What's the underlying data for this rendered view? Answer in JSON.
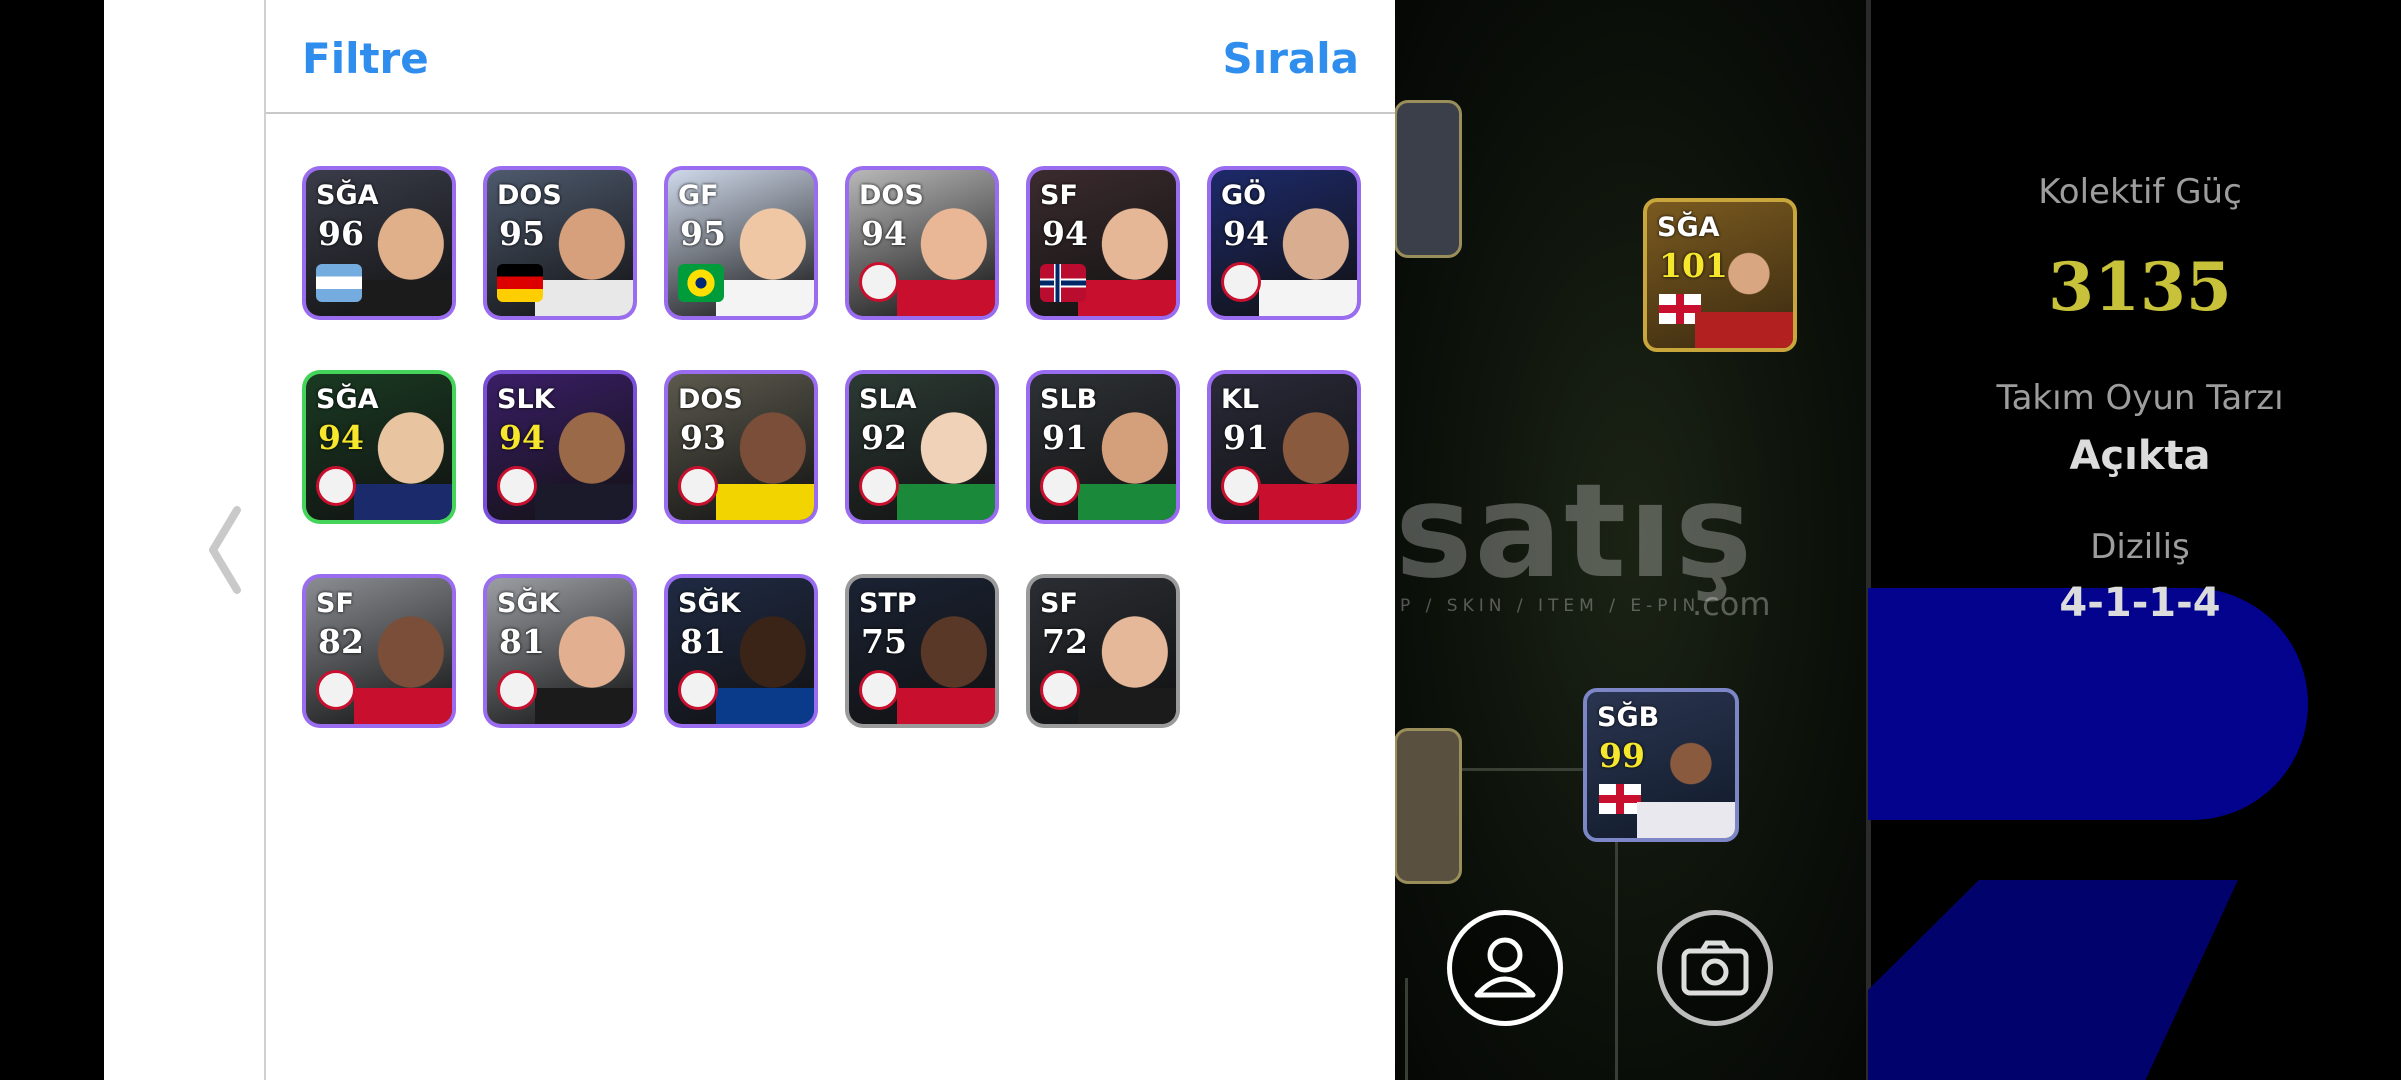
{
  "panel": {
    "filter_label": "Filtre",
    "sort_label": "Sırala"
  },
  "cards": [
    {
      "position": "SĞA",
      "rating": "96",
      "bg": "#3a3d4a",
      "frame": "#9a6cf0",
      "gold": false,
      "badge": "argentina-flag"
    },
    {
      "position": "DOS",
      "rating": "95",
      "bg": "#4e5a6e",
      "frame": "#9a6cf0",
      "gold": false,
      "badge": "germany-flag"
    },
    {
      "position": "GF",
      "rating": "95",
      "bg": "#cfd9ea",
      "frame": "#9a6cf0",
      "gold": false,
      "badge": "brazil-flag"
    },
    {
      "position": "DOS",
      "rating": "94",
      "bg": "#b8b8b8",
      "frame": "#9a6cf0",
      "gold": false,
      "badge": "man-utd-crest"
    },
    {
      "position": "SF",
      "rating": "94",
      "bg": "#3b2b2e",
      "frame": "#9a6cf0",
      "gold": false,
      "badge": "norway-flag"
    },
    {
      "position": "GÖ",
      "rating": "94",
      "bg": "#1d2a6a",
      "frame": "#9a6cf0",
      "gold": false,
      "badge": "real-madrid-crest"
    },
    {
      "position": "SĞA",
      "rating": "94",
      "bg": "#1a3a22",
      "frame": "#45d45a",
      "gold": true,
      "badge": "psg-crest"
    },
    {
      "position": "SLK",
      "rating": "94",
      "bg": "#3a1e66",
      "frame": "#7a50d8",
      "gold": true,
      "badge": "barcelona-crest"
    },
    {
      "position": "DOS",
      "rating": "93",
      "bg": "#5c5a4e",
      "frame": "#9a6cf0",
      "gold": false,
      "badge": "fenerbahce-crest"
    },
    {
      "position": "SLA",
      "rating": "92",
      "bg": "#2c3a34",
      "frame": "#9a6cf0",
      "gold": false,
      "badge": "celtic-crest"
    },
    {
      "position": "SLB",
      "rating": "91",
      "bg": "#2e3236",
      "frame": "#9a6cf0",
      "gold": false,
      "badge": "konyaspor-crest"
    },
    {
      "position": "KL",
      "rating": "91",
      "bg": "#2a2a3a",
      "frame": "#9a6cf0",
      "gold": false,
      "badge": "kayserispor-crest"
    },
    {
      "position": "SF",
      "rating": "82",
      "bg": "#8a8d92",
      "frame": "#9a6cf0",
      "gold": false,
      "badge": "man-utd-crest"
    },
    {
      "position": "SĞK",
      "rating": "81",
      "bg": "#9b9ea3",
      "frame": "#9a6cf0",
      "gold": false,
      "badge": "man-utd-crest"
    },
    {
      "position": "SĞK",
      "rating": "81",
      "bg": "#1f2a44",
      "frame": "#9a6cf0",
      "gold": false,
      "badge": "inter-crest"
    },
    {
      "position": "STP",
      "rating": "75",
      "bg": "#1a2233",
      "frame": "#9a9a9a",
      "gold": false,
      "badge": "club-crest"
    },
    {
      "position": "SF",
      "rating": "72",
      "bg": "#2a2d33",
      "frame": "#9a9a9a",
      "gold": false,
      "badge": "club-crest"
    }
  ],
  "field_cards": [
    {
      "position": "SĞA",
      "rating": "101"
    },
    {
      "position": "SĞB",
      "rating": "99"
    }
  ],
  "watermark": {
    "main": "satış",
    "sub": "P / SKIN / ITEM / E-PIN",
    "com": ".com"
  },
  "stats": {
    "power_label": "Kolektif Güç",
    "power_value": "3135",
    "style_label": "Takım Oyun Tarzı",
    "style_value": "Açıkta",
    "formation_label": "Diziliş",
    "formation_value": "4-1-1-4"
  },
  "colors": {
    "accent": "#2f8ded",
    "power": "#c8c23a"
  }
}
